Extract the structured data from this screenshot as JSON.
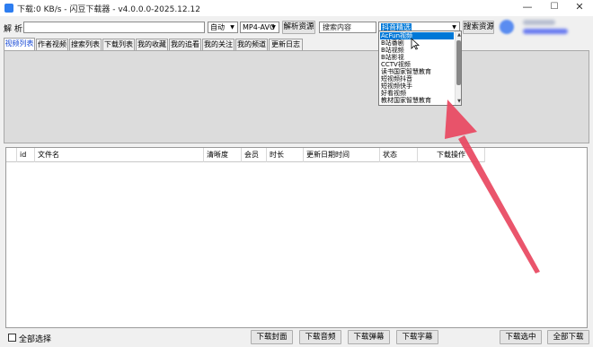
{
  "window": {
    "title": "下载:0 KB/s - 闪豆下载器 - v4.0.0.0-2025.12.12",
    "minimize_glyph": "—",
    "maximize_glyph": "☐",
    "close_glyph": "✕"
  },
  "toolbar": {
    "parse_label": "解 析:",
    "url_value": "",
    "quality_value": "自动",
    "format_value": "MP4-AVC",
    "parse_button": "解析资源",
    "search_placeholder": "搜索内容",
    "source_value": "抖音精选",
    "search_button": "搜索资源",
    "dropdown_arrow": "▼"
  },
  "tabs": [
    "视频列表",
    "作者视频",
    "搜索列表",
    "下载列表",
    "我的收藏",
    "我的追看",
    "我的关注",
    "我的频道",
    "更新日志"
  ],
  "active_tab": 0,
  "source_dropdown": {
    "items": [
      "AcFun视频",
      "B站番剧",
      "B站视频",
      "B站影视",
      "CCTV视频",
      "读书国家智慧教育",
      "短视频抖音",
      "短视频快手",
      "好看视频",
      "教材国家智慧教育"
    ],
    "selected_index": 0,
    "up_glyph": "▲",
    "down_glyph": "▼"
  },
  "table": {
    "columns": [
      "",
      "id",
      "文件名",
      "清晰度",
      "会员",
      "时长",
      "更新日期时间",
      "状态",
      "下载操作"
    ],
    "rows": []
  },
  "footer": {
    "select_all_label": "全部选择",
    "buttons": [
      "下载封面",
      "下载音频",
      "下载弹幕",
      "下载字幕"
    ],
    "download_selected": "下载选中",
    "download_all": "全部下载"
  },
  "colors": {
    "accent": "#0078d7",
    "annotation_arrow": "#e8475f",
    "active_tab_text": "#1a4bd6"
  }
}
